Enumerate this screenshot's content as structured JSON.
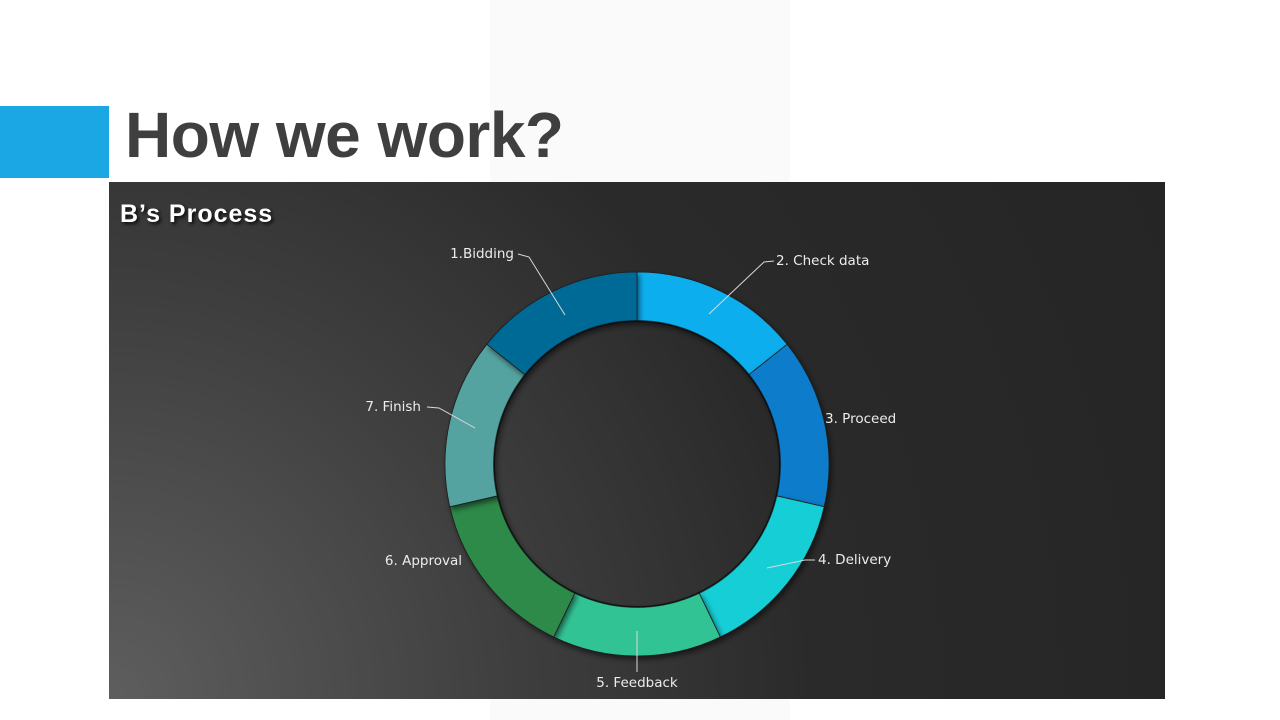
{
  "slide": {
    "title": "How we work?",
    "accent_color": "#1aa7e3"
  },
  "chart_data": {
    "type": "pie",
    "variant": "donut",
    "title": "B’s Process",
    "categories": [
      "1.Bidding",
      "2. Check data",
      "3. Proceed",
      "4. Delivery",
      "5. Feedback",
      "6. Approval",
      "7. Finish"
    ],
    "values": [
      1,
      1,
      1,
      1,
      1,
      1,
      1
    ],
    "colors": [
      "#006a96",
      "#08aeee",
      "#0b7ccb",
      "#14ced6",
      "#30c394",
      "#2f8a48",
      "#55a3a1"
    ],
    "legend": "none",
    "data_labels": "outside-with-leader-lines"
  }
}
